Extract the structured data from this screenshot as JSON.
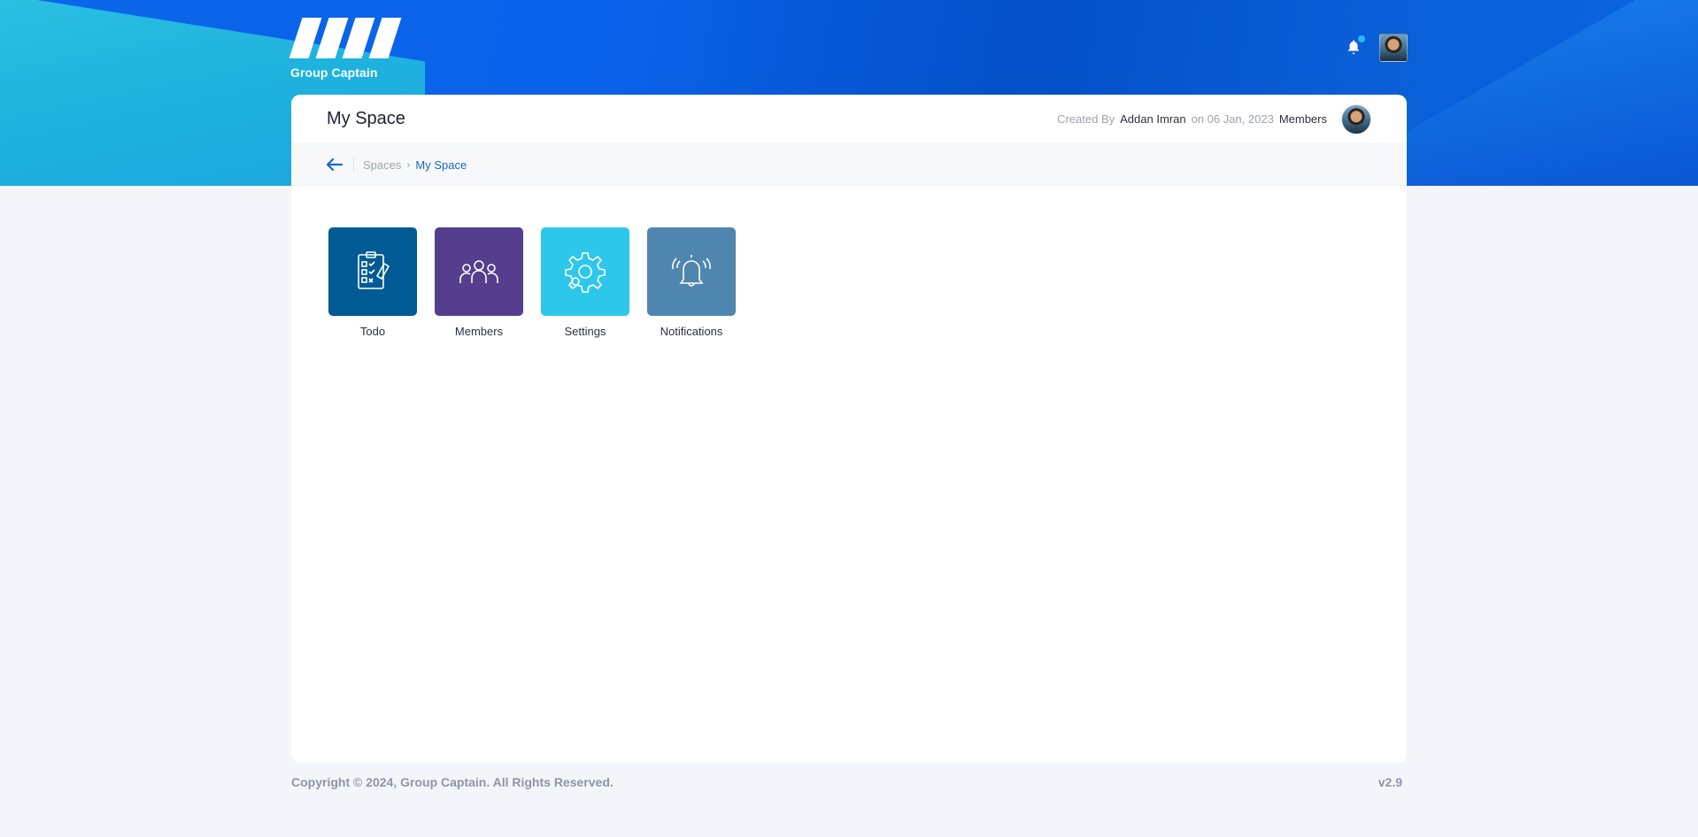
{
  "brand": {
    "name": "Group Captain"
  },
  "header": {
    "notification_dot_color": "#2bb6f5",
    "avatar_alt": "user-avatar"
  },
  "page": {
    "title": "My Space",
    "created_by_label": "Created By",
    "created_by_name": "Addan Imran",
    "created_on": "on 06 Jan, 2023",
    "members_label": "Members"
  },
  "breadcrumb": {
    "items": [
      {
        "label": "Spaces"
      },
      {
        "label": "My Space"
      }
    ]
  },
  "tiles": [
    {
      "label": "Todo",
      "color": "#005a94",
      "icon": "clipboard-checklist-icon"
    },
    {
      "label": "Members",
      "color": "#543e8d",
      "icon": "users-group-icon"
    },
    {
      "label": "Settings",
      "color": "#2ec7ec",
      "icon": "gear-icon"
    },
    {
      "label": "Notifications",
      "color": "#4f86b0",
      "icon": "bell-ringing-icon"
    }
  ],
  "footer": {
    "copyright": "Copyright © 2024, Group Captain. All Rights Reserved.",
    "version": "v2.9"
  }
}
